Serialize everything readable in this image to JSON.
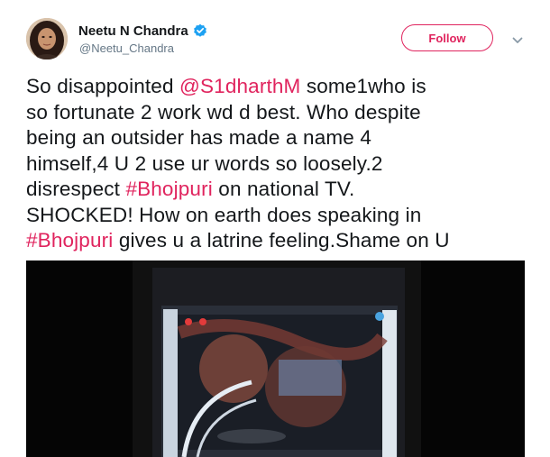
{
  "user": {
    "display_name": "Neetu N Chandra",
    "handle": "@Neetu_Chandra",
    "verified": true
  },
  "actions": {
    "follow_label": "Follow",
    "menu_icon": "chevron-down-icon"
  },
  "tweet": {
    "lines": [
      [
        {
          "type": "text",
          "text": "So disappointed "
        },
        {
          "type": "mention",
          "text": "@S1dharthM"
        },
        {
          "type": "text",
          "text": " some1who is"
        }
      ],
      [
        {
          "type": "text",
          "text": "so fortunate 2 work wd d best. Who despite"
        }
      ],
      [
        {
          "type": "text",
          "text": "being an outsider has made a name 4"
        }
      ],
      [
        {
          "type": "text",
          "text": "himself,4 U 2 use ur words so loosely.2"
        }
      ],
      [
        {
          "type": "text",
          "text": "disrespect "
        },
        {
          "type": "hashtag",
          "text": "#Bhojpuri"
        },
        {
          "type": "text",
          "text": " on national TV."
        }
      ],
      [
        {
          "type": "text",
          "text": "SHOCKED! How on earth does speaking in"
        }
      ],
      [
        {
          "type": "hashtag",
          "text": "#Bhojpuri"
        },
        {
          "type": "text",
          "text": " gives u a latrine feeling.Shame on U"
        }
      ]
    ]
  },
  "colors": {
    "link": "#e0245e",
    "text": "#14171a",
    "secondary": "#657786",
    "verified": "#1da1f2"
  }
}
